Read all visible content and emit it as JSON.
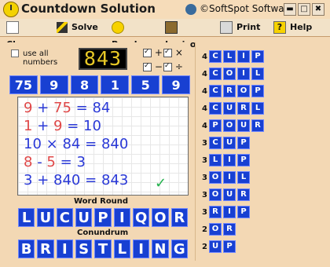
{
  "window": {
    "title": "Countdown Solution",
    "publisher": "©SoftSpot Software",
    "controls": {
      "minimize": "▬",
      "maximize": "□",
      "close": "✖"
    }
  },
  "toolbar": {
    "clear": "Clear",
    "solve": "Solve",
    "puzzle": "Puzzle",
    "lexicon": "Lexicon",
    "print": "Print",
    "help": "Help",
    "help_icon": "?"
  },
  "numbers_round": {
    "use_all_label": "use all",
    "use_all_label2": "numbers",
    "target": "843",
    "operators": {
      "plus": "+",
      "times": "×",
      "minus": "−",
      "divide": "÷"
    },
    "numbers": [
      "75",
      "9",
      "8",
      "1",
      "5",
      "9"
    ],
    "solution_lines": [
      {
        "a": "9",
        "op": "+",
        "b": "75",
        "eq": "=",
        "r": "84"
      },
      {
        "a": "1",
        "op": "+",
        "b": "9",
        "eq": "=",
        "r": "10"
      },
      {
        "a": "10",
        "op": "×",
        "b": "84",
        "eq": "=",
        "r": "840"
      },
      {
        "a": "8",
        "op": "-",
        "b": "5",
        "eq": "=",
        "r": "3"
      },
      {
        "a": "3",
        "op": "+",
        "b": "840",
        "eq": "=",
        "r": "843"
      }
    ],
    "done_mark": "✓"
  },
  "word_round": {
    "label": "Word Round",
    "letters": [
      "L",
      "U",
      "C",
      "U",
      "P",
      "I",
      "Q",
      "O",
      "R"
    ]
  },
  "conundrum": {
    "label": "Conundrum",
    "letters": [
      "B",
      "R",
      "I",
      "S",
      "T",
      "L",
      "I",
      "N",
      "G"
    ]
  },
  "results": [
    {
      "len": "4",
      "word": [
        "C",
        "L",
        "I",
        "P"
      ]
    },
    {
      "len": "4",
      "word": [
        "C",
        "O",
        "I",
        "L"
      ]
    },
    {
      "len": "4",
      "word": [
        "C",
        "R",
        "O",
        "P"
      ]
    },
    {
      "len": "4",
      "word": [
        "C",
        "U",
        "R",
        "L"
      ]
    },
    {
      "len": "4",
      "word": [
        "P",
        "O",
        "U",
        "R"
      ]
    },
    {
      "len": "3",
      "word": [
        "C",
        "U",
        "P"
      ]
    },
    {
      "len": "3",
      "word": [
        "L",
        "I",
        "P"
      ]
    },
    {
      "len": "3",
      "word": [
        "O",
        "I",
        "L"
      ]
    },
    {
      "len": "3",
      "word": [
        "O",
        "U",
        "R"
      ]
    },
    {
      "len": "3",
      "word": [
        "R",
        "I",
        "P"
      ]
    },
    {
      "len": "2",
      "word": [
        "O",
        "R"
      ]
    },
    {
      "len": "2",
      "word": [
        "U",
        "P"
      ]
    }
  ],
  "colors": {
    "tile_blue": "#1840d2",
    "target_yellow": "#e7c826",
    "solution_red": "#e04848",
    "solution_blue": "#2a39d7",
    "check_green": "#22b14c",
    "background_tan": "#f3d8b4"
  }
}
